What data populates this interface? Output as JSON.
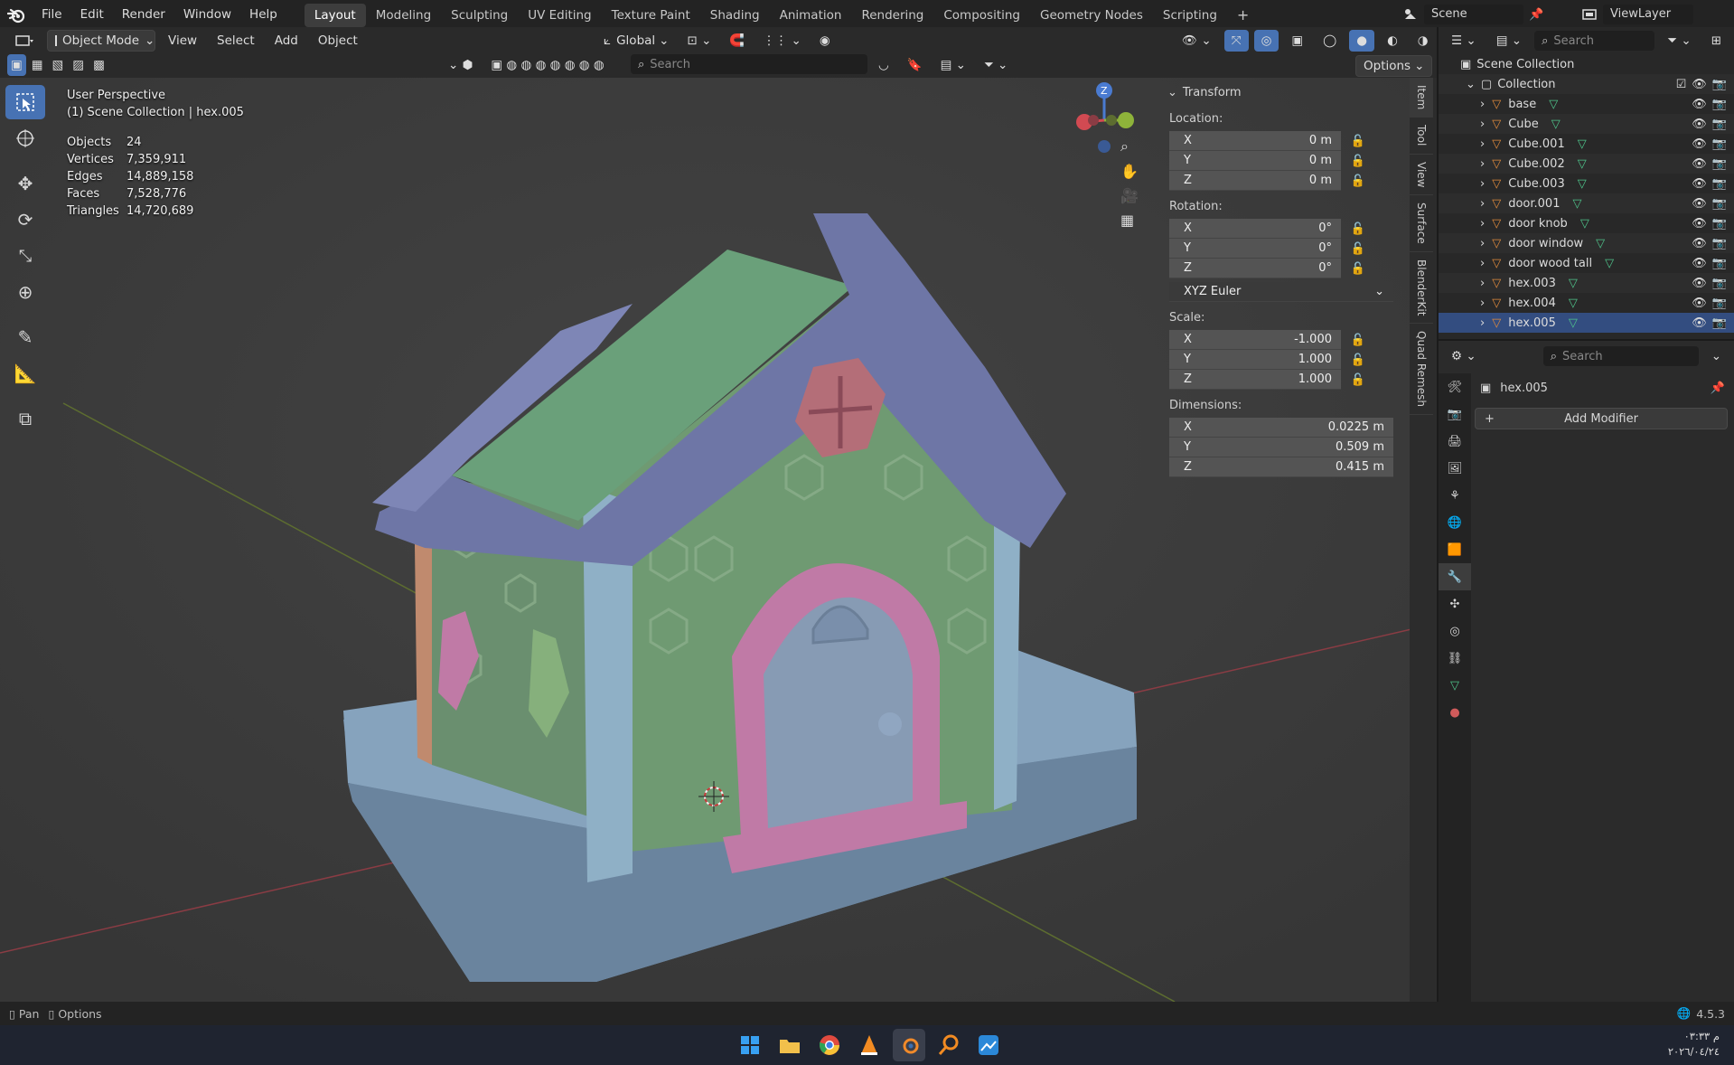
{
  "menu": {
    "items": [
      "File",
      "Edit",
      "Render",
      "Window",
      "Help"
    ],
    "workspaces": [
      "Layout",
      "Modeling",
      "Sculpting",
      "UV Editing",
      "Texture Paint",
      "Shading",
      "Animation",
      "Rendering",
      "Compositing",
      "Geometry Nodes",
      "Scripting"
    ],
    "active_workspace": "Layout",
    "scene": "Scene",
    "view_layer": "ViewLayer"
  },
  "viewport_header": {
    "mode": "Object Mode",
    "menus": [
      "View",
      "Select",
      "Add",
      "Object"
    ],
    "orientation": "Global",
    "search_placeholder": "Search",
    "options_label": "Options"
  },
  "viewport": {
    "title": "User Perspective",
    "subtitle": "(1) Scene Collection | hex.005",
    "stats": [
      {
        "label": "Objects",
        "value": "24"
      },
      {
        "label": "Vertices",
        "value": "7,359,911"
      },
      {
        "label": "Edges",
        "value": "14,889,158"
      },
      {
        "label": "Faces",
        "value": "7,528,776"
      },
      {
        "label": "Triangles",
        "value": "14,720,689"
      }
    ],
    "gizmo_z": "Z"
  },
  "npanel": {
    "header": "Transform",
    "location_label": "Location:",
    "location": [
      {
        "axis": "X",
        "value": "0 m"
      },
      {
        "axis": "Y",
        "value": "0 m"
      },
      {
        "axis": "Z",
        "value": "0 m"
      }
    ],
    "rotation_label": "Rotation:",
    "rotation": [
      {
        "axis": "X",
        "value": "0°"
      },
      {
        "axis": "Y",
        "value": "0°"
      },
      {
        "axis": "Z",
        "value": "0°"
      }
    ],
    "rotation_mode": "XYZ Euler",
    "scale_label": "Scale:",
    "scale": [
      {
        "axis": "X",
        "value": "-1.000"
      },
      {
        "axis": "Y",
        "value": "1.000"
      },
      {
        "axis": "Z",
        "value": "1.000"
      }
    ],
    "dimensions_label": "Dimensions:",
    "dimensions": [
      {
        "axis": "X",
        "value": "0.0225 m"
      },
      {
        "axis": "Y",
        "value": "0.509 m"
      },
      {
        "axis": "Z",
        "value": "0.415 m"
      }
    ],
    "tabs": [
      "Item",
      "Tool",
      "View",
      "Surface",
      "BlenderKit",
      "Quad Remesh"
    ]
  },
  "outliner": {
    "search_placeholder": "Search",
    "root": "Scene Collection",
    "collection": "Collection",
    "items": [
      "base",
      "Cube",
      "Cube.001",
      "Cube.002",
      "Cube.003",
      "door.001",
      "door knob",
      "door window",
      "door wood tall",
      "hex.003",
      "hex.004",
      "hex.005"
    ],
    "selected": "hex.005"
  },
  "properties": {
    "search_placeholder": "Search",
    "object_name": "hex.005",
    "add_modifier": "Add Modifier"
  },
  "statusbar": {
    "left1": "Pan",
    "left2": "Options",
    "version": "4.5.3"
  },
  "taskbar": {
    "time": "م ٠٣:٣٣",
    "date": "٢٠٢٦/٠٤/٢٤"
  },
  "colors": {
    "accent": "#4772b3",
    "roof": "#6e76a6",
    "walls": "#6f9a72",
    "trim": "#8fb0c6",
    "pink": "#c07aa6",
    "base": "#7893ad"
  }
}
